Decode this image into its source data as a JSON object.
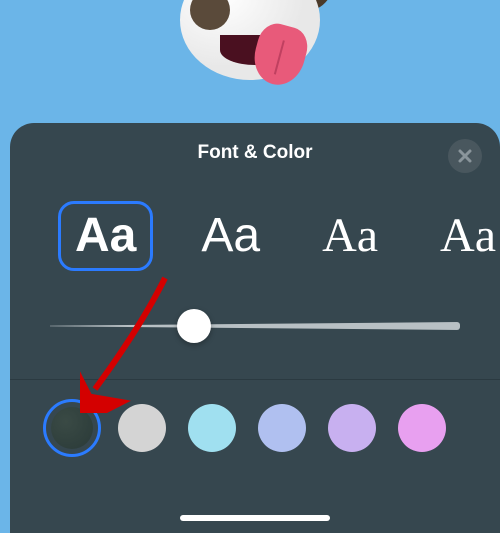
{
  "sheet": {
    "title": "Font & Color"
  },
  "fonts": [
    {
      "sample": "Aa",
      "selected": true
    },
    {
      "sample": "Aa",
      "selected": false
    },
    {
      "sample": "Aa",
      "selected": false
    },
    {
      "sample": "Aa",
      "selected": false
    }
  ],
  "slider": {
    "value_percent": 35
  },
  "colors": [
    {
      "name": "dark-teal",
      "hex": "#2f3f3c",
      "selected": true
    },
    {
      "name": "light-gray",
      "hex": "#d4d4d4",
      "selected": false
    },
    {
      "name": "sky-blue",
      "hex": "#a0e0f0",
      "selected": false
    },
    {
      "name": "periwinkle",
      "hex": "#b0c0f0",
      "selected": false
    },
    {
      "name": "lavender",
      "hex": "#c8b0f0",
      "selected": false
    },
    {
      "name": "pink",
      "hex": "#e8a0f0",
      "selected": false
    }
  ],
  "annotation": {
    "arrow_color": "#d40000"
  },
  "accent_color": "#2b7bff",
  "sheet_bg": "#36474f"
}
